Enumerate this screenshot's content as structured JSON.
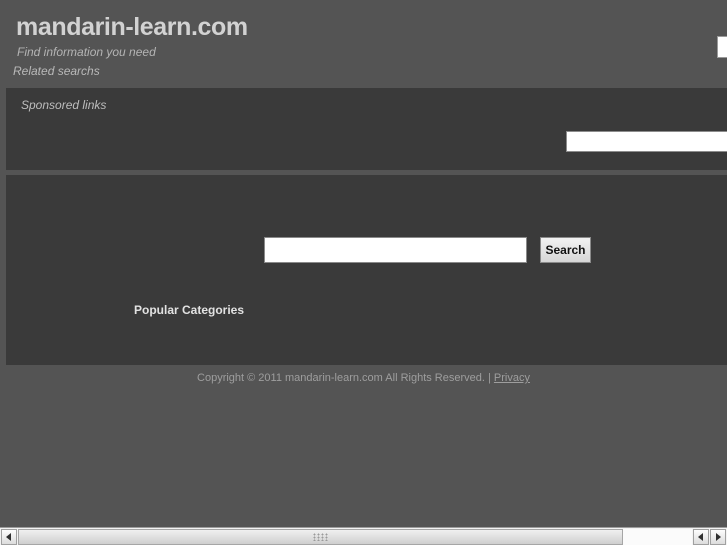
{
  "page": {
    "background_color": "#545454",
    "panel_color": "#3a3a3a"
  },
  "header": {
    "site_title": "mandarin-learn.com",
    "tagline": "Find information you need",
    "related_searches_label": "Related searchs"
  },
  "sponsored": {
    "label": "Sponsored links",
    "input_value": "",
    "input_placeholder": ""
  },
  "main": {
    "search": {
      "input_value": "",
      "input_placeholder": "",
      "button_label": "Search"
    },
    "popular_categories_heading": "Popular Categories"
  },
  "footer": {
    "copyright_text": "Copyright © 2011 mandarin-learn.com All Rights Reserved. | ",
    "privacy_label": "Privacy"
  },
  "scrollbar": {
    "left_arrow": "◀",
    "right_arrow": "▶",
    "orientation": "horizontal"
  }
}
